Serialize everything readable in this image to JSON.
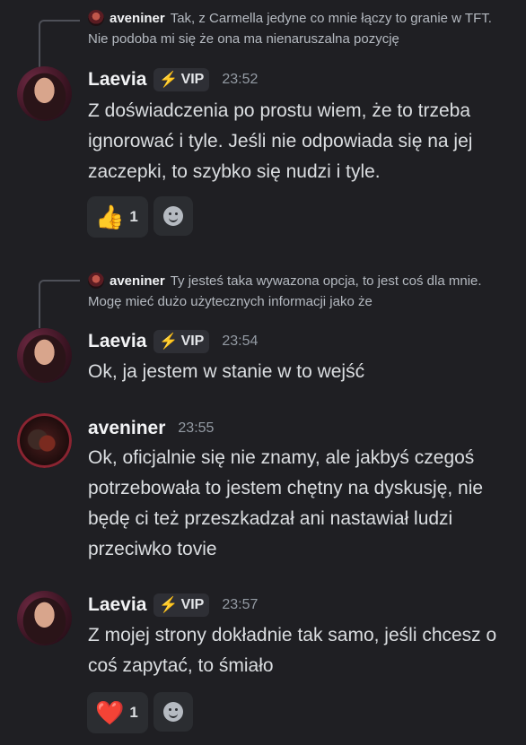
{
  "messages": [
    {
      "reply": {
        "author": "aveniner",
        "text": "Tak, z Carmella jedyne co mnie łączy to granie w TFT. Nie podoba mi się że ona ma nienaruszalna pozycję"
      },
      "author": "Laevia",
      "badge": "VIP",
      "time": "23:52",
      "text": "Z doświadczenia po prostu wiem, że to trzeba ignorować i tyle. Jeśli nie odpowiada się na jej zaczepki, to szybko się nudzi i tyle.",
      "reaction": {
        "emoji": "👍",
        "emoji_name": "thumbs-up",
        "count": "1"
      }
    },
    {
      "reply": {
        "author": "aveniner",
        "text": "Ty jesteś taka wywazona opcja, to jest coś dla mnie. Mogę mieć dużo użytecznych informacji jako że"
      },
      "author": "Laevia",
      "badge": "VIP",
      "time": "23:54",
      "text": "Ok, ja jestem w stanie w to wejść"
    },
    {
      "author": "aveniner",
      "time": "23:55",
      "text": "Ok, oficjalnie się nie znamy, ale jakbyś czegoś potrzebowała to jestem chętny na dyskusję, nie będę ci też przeszkadzał ani nastawiał ludzi przeciwko tovie"
    },
    {
      "author": "Laevia",
      "badge": "VIP",
      "time": "23:57",
      "text": "Z mojej strony dokładnie tak samo, jeśli chcesz o coś zapytać, to śmiało",
      "reaction": {
        "emoji": "❤️",
        "emoji_name": "red-heart",
        "count": "1"
      }
    }
  ],
  "colors": {
    "background": "#1f1f23",
    "accent_bolt": "#f4c23b",
    "reaction_bg": "#2b2d31"
  }
}
